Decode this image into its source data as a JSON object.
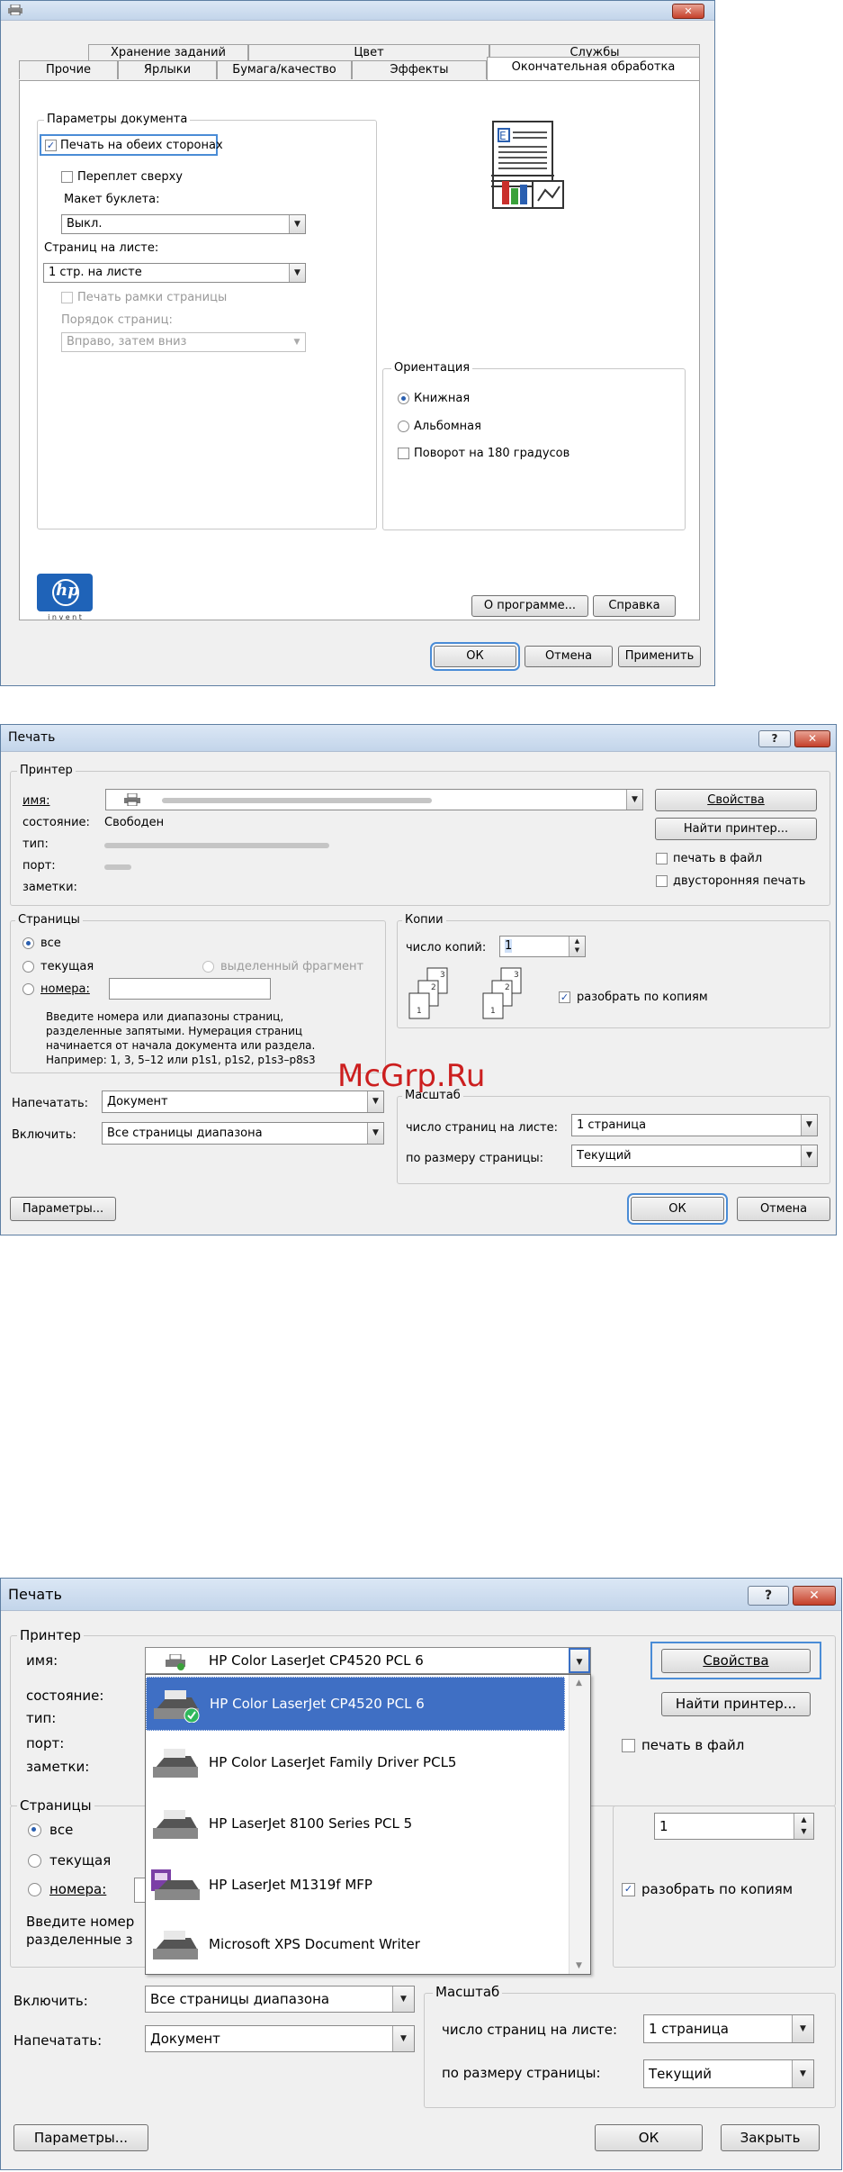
{
  "d1": {
    "tabs_top": [
      "Хранение заданий",
      "Цвет",
      "Службы"
    ],
    "tabs_bottom": [
      "Прочие",
      "Ярлыки",
      "Бумага/качество",
      "Эффекты",
      "Окончательная обработка"
    ],
    "doc_params_label": "Параметры документа",
    "duplex_label": "Печать на обеих сторонах",
    "flip_up_label": "Переплет сверху",
    "booklet_label": "Макет буклета:",
    "booklet_value": "Выкл.",
    "pages_per_sheet_label": "Страниц на листе:",
    "pages_per_sheet_value": "1 стр. на листе",
    "print_borders_label": "Печать рамки страницы",
    "page_order_label": "Порядок страниц:",
    "page_order_value": "Вправо, затем вниз",
    "orientation_label": "Ориентация",
    "portrait_label": "Книжная",
    "landscape_label": "Альбомная",
    "rotate_label": "Поворот на 180 градусов",
    "hp_logo_text": "hp",
    "hp_invent_text": "i n v e n t",
    "about_button": "О программе...",
    "help_button": "Справка",
    "ok_button": "ОК",
    "cancel_button": "Отмена",
    "apply_button": "Применить"
  },
  "d2": {
    "title": "Печать",
    "help_glyph": "?",
    "close_glyph": "✕",
    "printer_group": "Принтер",
    "name_label": "имя:",
    "status_label": "состояние:",
    "status_value": "Свободен",
    "type_label": "тип:",
    "port_label": "порт:",
    "notes_label": "заметки:",
    "properties_button": "Свойства",
    "find_printer_button": "Найти принтер...",
    "print_to_file_label": "печать в файл",
    "duplex_label": "двусторонняя печать",
    "pages_group": "Страницы",
    "all_label": "все",
    "current_label": "текущая",
    "selection_label": "выделенный фрагмент",
    "pages_label": "номера:",
    "hint_lines": [
      "Введите номера или диапазоны страниц,",
      "разделенные запятыми. Нумерация страниц",
      "начинается от начала документа или раздела.",
      "Например: 1, 3, 5–12 или p1s1, p1s2, p1s3–p8s3"
    ],
    "copies_group": "Копии",
    "copies_label": "число копий:",
    "copies_value": "1",
    "collate_label": "разобрать по копиям",
    "print_what_label": "Напечатать:",
    "print_what_value": "Документ",
    "include_label": "Включить:",
    "include_value": "Все страницы диапазона",
    "scale_group": "Масштаб",
    "pps_label": "число страниц на листе:",
    "pps_value": "1 страница",
    "fit_label": "по размеру страницы:",
    "fit_value": "Текущий",
    "options_button": "Параметры...",
    "ok_button": "ОК",
    "cancel_button": "Отмена",
    "watermark": "McGrp.Ru"
  },
  "d3": {
    "title": "Печать",
    "help_glyph": "?",
    "close_glyph": "✕",
    "printer_group": "Принтер",
    "name_label": "имя:",
    "status_label": "состояние:",
    "type_label": "тип:",
    "port_label": "порт:",
    "notes_label": "заметки:",
    "selected_printer": "HP Color LaserJet CP4520 PCL 6",
    "printers": [
      "HP Color LaserJet CP4520 PCL 6",
      "HP Color LaserJet Family Driver PCL5",
      "HP LaserJet 8100 Series PCL 5",
      "HP LaserJet M1319f MFP",
      "Microsoft XPS Document Writer"
    ],
    "properties_button": "Свойства",
    "find_printer_button": "Найти принтер...",
    "print_to_file_label": "печать в файл",
    "pages_group": "Страницы",
    "all_label": "все",
    "current_label": "текущая",
    "pages_label": "номера:",
    "hint_partial": [
      "Введите номер",
      "разделенные з"
    ],
    "copies_value": "1",
    "collate_label": "разобрать по копиям",
    "include_label": "Включить:",
    "include_value": "Все страницы диапазона",
    "print_what_label": "Напечатать:",
    "print_what_value": "Документ",
    "scale_group": "Масштаб",
    "pps_label": "число страниц на листе:",
    "pps_value": "1 страница",
    "fit_label": "по размеру страницы:",
    "fit_value": "Текущий",
    "options_button": "Параметры...",
    "ok_button": "ОК",
    "close_button": "Закрыть"
  }
}
